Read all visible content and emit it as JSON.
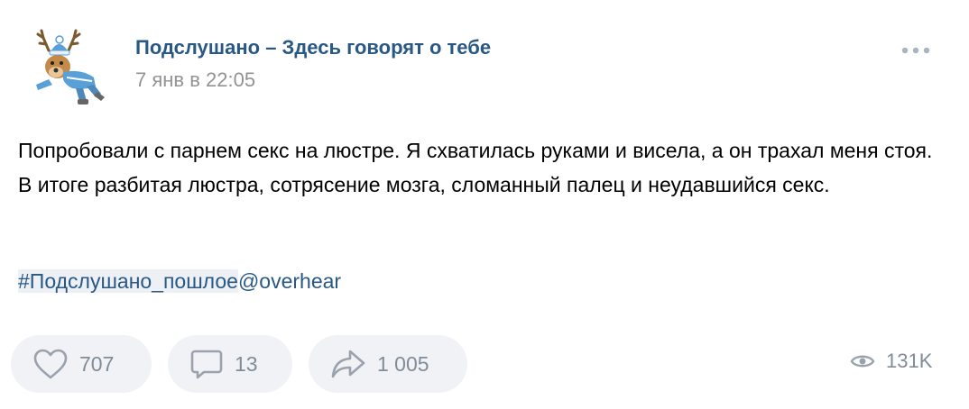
{
  "post": {
    "author": "Подслушано – Здесь говорят о тебе",
    "date": "7 янв в 22:05",
    "text": "Попробовали с парнем секс на люстре. Я схватилась руками и висела, а он трахал меня стоя. В итоге разбитая люстра, сотрясение мозга, сломанный палец и неудавшийся секс.",
    "hashtag": "#Подслушано_пошлое",
    "hashtag_suffix": "@overhear"
  },
  "actions": {
    "likes": "707",
    "comments": "13",
    "shares": "1 005",
    "views": "131K"
  },
  "icons": {
    "more": "more-horizontal-icon",
    "like": "heart-icon",
    "comment": "comment-bubble-icon",
    "share": "share-arrow-icon",
    "views": "eye-icon"
  },
  "colors": {
    "link": "#2a5885",
    "muted": "#939393",
    "icon": "#818c99",
    "button_bg": "#f0f2f5"
  }
}
